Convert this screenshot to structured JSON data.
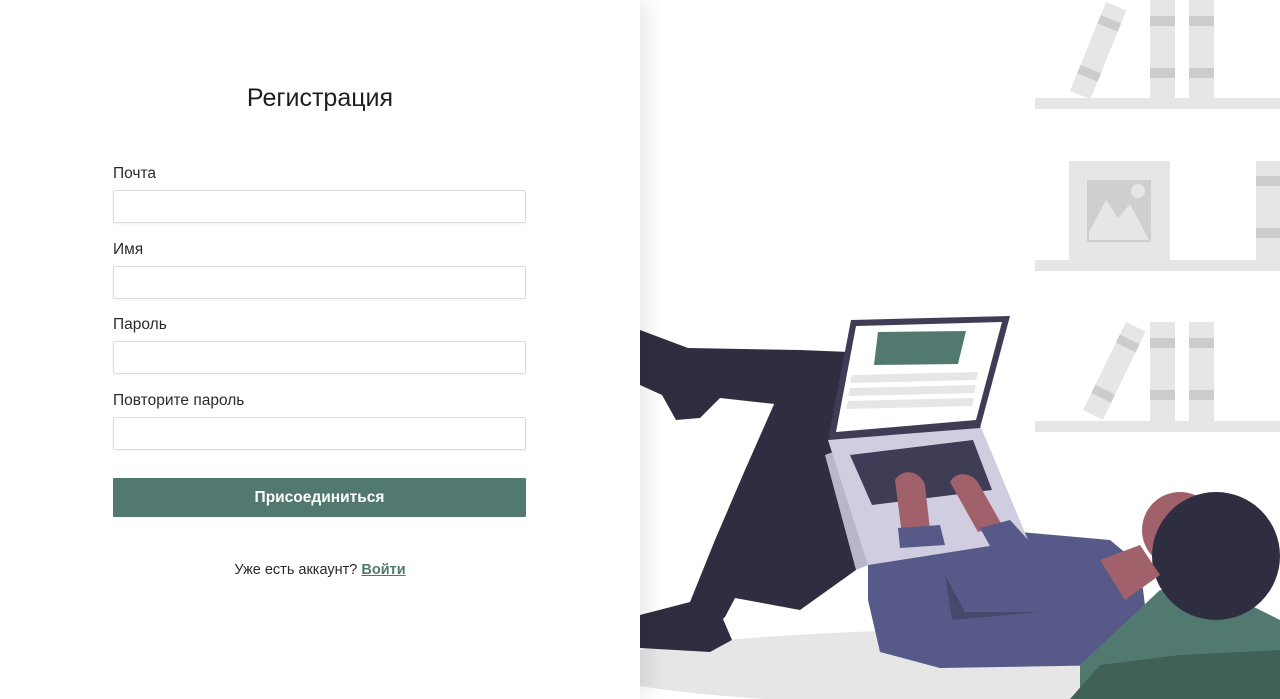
{
  "form": {
    "title": "Регистрация",
    "fields": [
      {
        "label": "Почта",
        "value": "",
        "placeholder": ""
      },
      {
        "label": "Имя",
        "value": "",
        "placeholder": ""
      },
      {
        "label": "Пароль",
        "value": "",
        "placeholder": ""
      },
      {
        "label": "Повторите пароль",
        "value": "",
        "placeholder": ""
      }
    ],
    "submit_label": "Присоединиться",
    "login_prompt": "Уже есть аккаунт?",
    "login_link": "Войти"
  },
  "colors": {
    "accent": "#52796f",
    "shelf": "#e6e6e6",
    "dark": "#2f2e41",
    "sweater": "#575a89",
    "skin": "#a0616a"
  },
  "illustration": {
    "icon": "person-with-laptop-illustration"
  }
}
